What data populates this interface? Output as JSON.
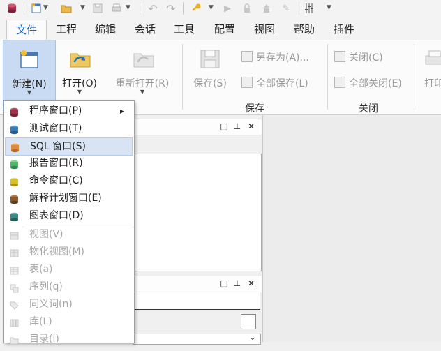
{
  "quick_access": {
    "icons": [
      "app-db-icon",
      "new-doc-icon",
      "open-folder-icon",
      "save-icon",
      "print-icon",
      "undo-icon",
      "redo-icon",
      "key-icon",
      "run-icon",
      "lock-icon",
      "upload-icon",
      "pin-icon",
      "sliders-icon",
      "customize-icon"
    ]
  },
  "menubar": {
    "tabs": [
      "文件",
      "工程",
      "编辑",
      "会话",
      "工具",
      "配置",
      "视图",
      "帮助",
      "插件"
    ],
    "active": "文件"
  },
  "ribbon": {
    "new_label": "新建(N)",
    "open_label": "打开(O)",
    "reopen_label": "重新打开(R)",
    "save_label": "保存(S)",
    "save_as_label": "另存为(A)...",
    "save_all_label": "全部保存(L)",
    "close_label": "关闭(C)",
    "close_all_label": "全部关闭(E)",
    "print_label": "打印",
    "group_save": "保存",
    "group_close": "关闭"
  },
  "dropdown": {
    "items": [
      {
        "label": "程序窗口(P)",
        "enabled": true,
        "submenu": true,
        "color": "#a0304a"
      },
      {
        "label": "测试窗口(T)",
        "enabled": true,
        "submenu": false,
        "color": "#3a7ab5"
      },
      {
        "label": "SQL 窗口(S)",
        "enabled": true,
        "submenu": false,
        "color": "#e08a3c",
        "highlighted": true
      },
      {
        "label": "报告窗口(R)",
        "enabled": true,
        "submenu": false,
        "color": "#4db86a"
      },
      {
        "label": "命令窗口(C)",
        "enabled": true,
        "submenu": false,
        "color": "#d8c21e"
      },
      {
        "label": "解释计划窗口(E)",
        "enabled": true,
        "submenu": false,
        "color": "#8a5a2a"
      },
      {
        "label": "图表窗口(D)",
        "enabled": true,
        "submenu": false,
        "color": "#3a8a86"
      },
      {
        "label": "视图(V)",
        "enabled": false
      },
      {
        "label": "物化视图(M)",
        "enabled": false
      },
      {
        "label": "表(a)",
        "enabled": false
      },
      {
        "label": "序列(q)",
        "enabled": false
      },
      {
        "label": "同义词(n)",
        "enabled": false
      },
      {
        "label": "库(L)",
        "enabled": false
      },
      {
        "label": "目录(i)",
        "enabled": false
      }
    ],
    "submenu_arrow": "▸"
  },
  "panels": {
    "controls": [
      "□",
      "⊥",
      "✕"
    ]
  }
}
